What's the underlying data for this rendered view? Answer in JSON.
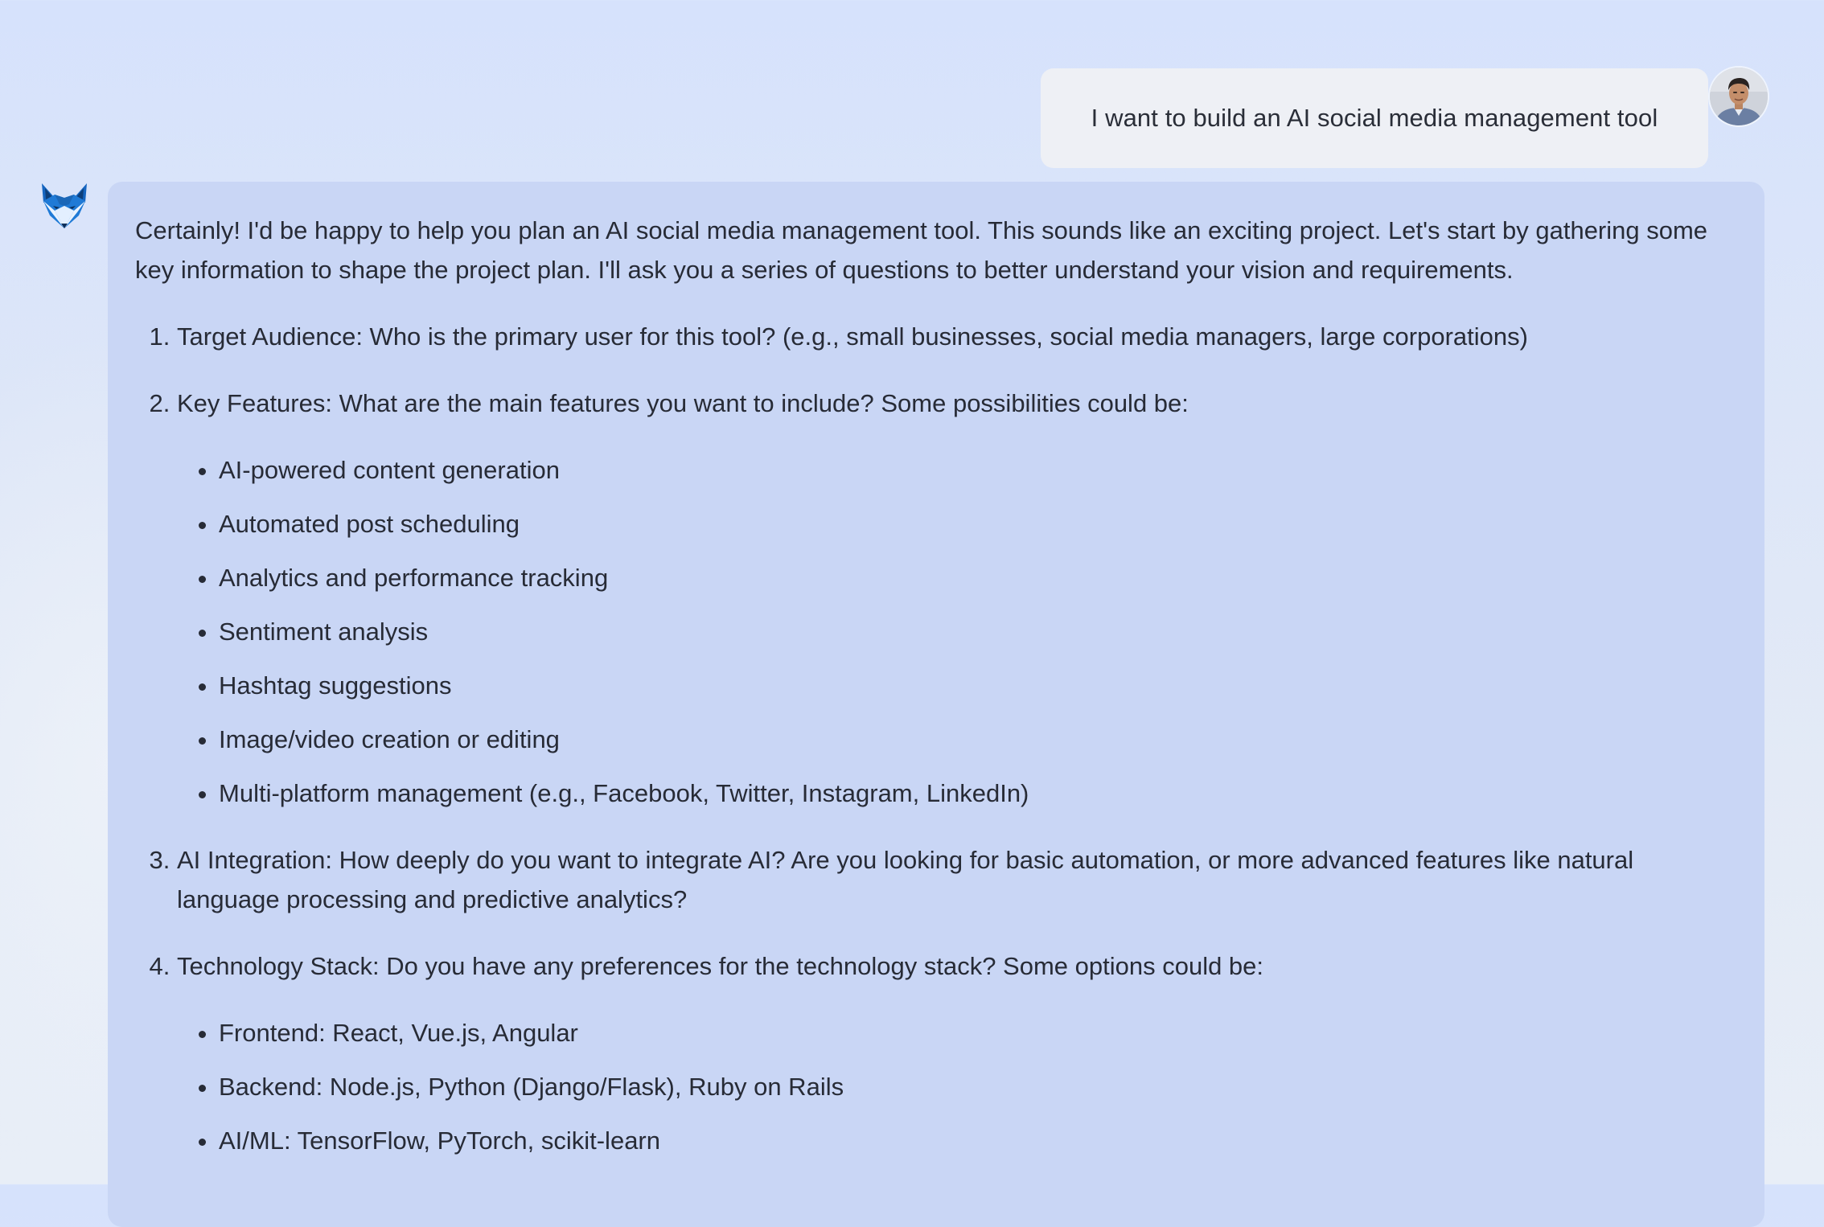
{
  "user_message": {
    "text": "I want to build an AI social media management tool"
  },
  "assistant_message": {
    "intro": "Certainly! I'd be happy to help you plan an AI social media management tool. This sounds like an exciting project. Let's start by gathering some key information to shape the project plan. I'll ask you a series of questions to better understand your vision and requirements.",
    "questions": [
      {
        "text": "Target Audience: Who is the primary user for this tool? (e.g., small businesses, social media managers, large corporations)"
      },
      {
        "text": "Key Features: What are the main features you want to include? Some possibilities could be:",
        "options": [
          "AI-powered content generation",
          "Automated post scheduling",
          "Analytics and performance tracking",
          "Sentiment analysis",
          "Hashtag suggestions",
          "Image/video creation or editing",
          "Multi-platform management (e.g., Facebook, Twitter, Instagram, LinkedIn)"
        ]
      },
      {
        "text": "AI Integration: How deeply do you want to integrate AI? Are you looking for basic automation, or more advanced features like natural language processing and predictive analytics?"
      },
      {
        "text": "Technology Stack: Do you have any preferences for the technology stack? Some options could be:",
        "options": [
          "Frontend: React, Vue.js, Angular",
          "Backend: Node.js, Python (Django/Flask), Ruby on Rails",
          "AI/ML: TensorFlow, PyTorch, scikit-learn"
        ]
      }
    ]
  },
  "icons": {
    "user_avatar": "user-avatar-photo",
    "assistant_avatar": "fox-logo-icon"
  },
  "colors": {
    "assistant_bubble": "#c9d6f5",
    "user_bubble": "#eef0f5",
    "fox_primary": "#1f7ad6"
  }
}
